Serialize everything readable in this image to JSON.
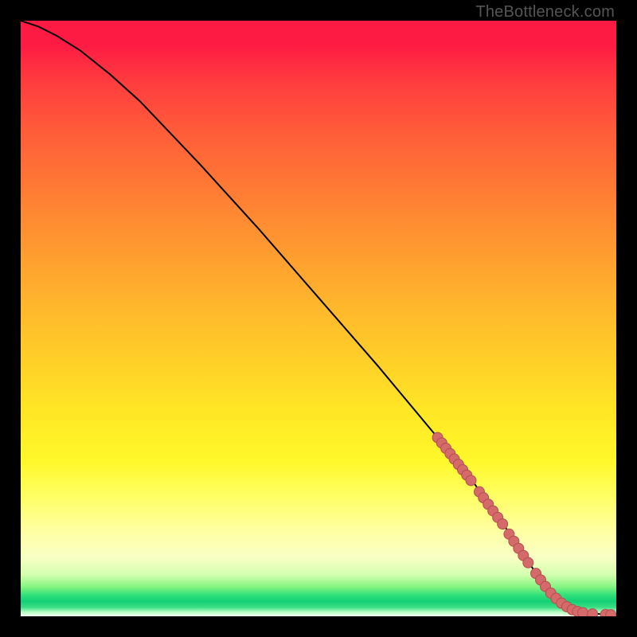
{
  "watermark": "TheBottleneck.com",
  "chart_data": {
    "type": "line",
    "title": "",
    "xlabel": "",
    "ylabel": "",
    "xlim": [
      0,
      100
    ],
    "ylim": [
      0,
      100
    ],
    "grid": false,
    "legend": false,
    "series": [
      {
        "name": "bottleneck-curve",
        "x": [
          0,
          3,
          6,
          10,
          15,
          20,
          30,
          40,
          50,
          60,
          70,
          76,
          80,
          82,
          84,
          86,
          88,
          90,
          92,
          94,
          96,
          98,
          100
        ],
        "y": [
          100,
          99,
          97.5,
          95,
          91,
          86.5,
          76,
          65,
          53.5,
          42,
          30,
          22.5,
          17,
          14,
          11,
          8,
          5.5,
          3.5,
          2,
          1,
          0.5,
          0.3,
          0.2
        ]
      }
    ],
    "markers": {
      "name": "highlighted-points",
      "description": "Salmon dots along lower-right portion of curve",
      "points": [
        {
          "x": 70.0,
          "y": 30.0
        },
        {
          "x": 70.7,
          "y": 29.1
        },
        {
          "x": 71.4,
          "y": 28.2
        },
        {
          "x": 72.1,
          "y": 27.3
        },
        {
          "x": 72.8,
          "y": 26.4
        },
        {
          "x": 73.5,
          "y": 25.5
        },
        {
          "x": 74.2,
          "y": 24.6
        },
        {
          "x": 74.9,
          "y": 23.7
        },
        {
          "x": 75.6,
          "y": 22.8
        },
        {
          "x": 77.0,
          "y": 20.9
        },
        {
          "x": 77.7,
          "y": 19.9
        },
        {
          "x": 78.5,
          "y": 18.8
        },
        {
          "x": 79.3,
          "y": 17.7
        },
        {
          "x": 80.1,
          "y": 16.6
        },
        {
          "x": 80.9,
          "y": 15.5
        },
        {
          "x": 82.0,
          "y": 13.8
        },
        {
          "x": 82.8,
          "y": 12.6
        },
        {
          "x": 83.6,
          "y": 11.4
        },
        {
          "x": 84.4,
          "y": 10.2
        },
        {
          "x": 85.2,
          "y": 9.0
        },
        {
          "x": 86.5,
          "y": 7.2
        },
        {
          "x": 87.3,
          "y": 6.1
        },
        {
          "x": 88.1,
          "y": 5.0
        },
        {
          "x": 89.0,
          "y": 3.9
        },
        {
          "x": 89.9,
          "y": 3.0
        },
        {
          "x": 90.8,
          "y": 2.2
        },
        {
          "x": 91.7,
          "y": 1.6
        },
        {
          "x": 92.6,
          "y": 1.1
        },
        {
          "x": 93.5,
          "y": 0.8
        },
        {
          "x": 94.4,
          "y": 0.6
        },
        {
          "x": 96.0,
          "y": 0.4
        },
        {
          "x": 98.2,
          "y": 0.3
        },
        {
          "x": 99.1,
          "y": 0.25
        }
      ]
    },
    "gradient_stops": [
      {
        "pos": 0.0,
        "color": "#fe1b43"
      },
      {
        "pos": 0.1,
        "color": "#ff3b3f"
      },
      {
        "pos": 0.28,
        "color": "#ff7a34"
      },
      {
        "pos": 0.48,
        "color": "#ffb72c"
      },
      {
        "pos": 0.66,
        "color": "#ffe826"
      },
      {
        "pos": 0.8,
        "color": "#ffff66"
      },
      {
        "pos": 0.9,
        "color": "#faffc4"
      },
      {
        "pos": 0.965,
        "color": "#2ce07a"
      },
      {
        "pos": 1.0,
        "color": "#f3fff0"
      }
    ]
  }
}
